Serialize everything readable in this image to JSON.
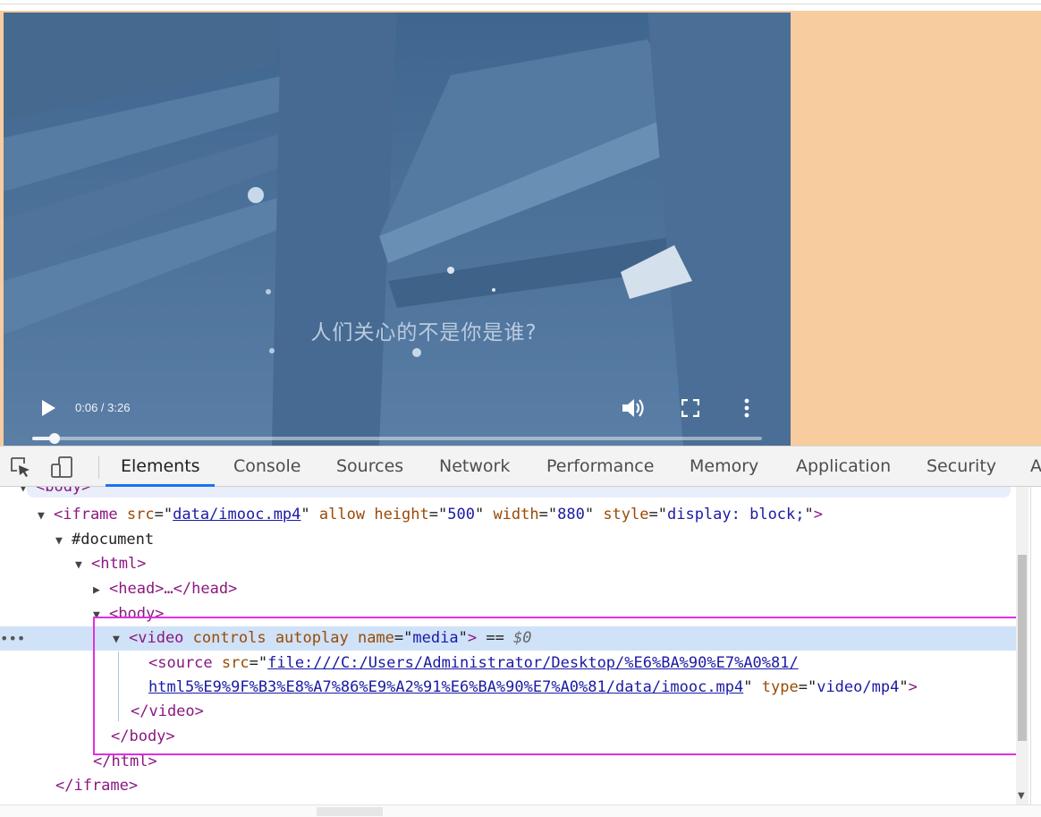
{
  "video": {
    "subtitle": "人们关心的不是你是谁?",
    "time": "0:06 / 3:26",
    "progress_fraction": 0.0306,
    "play_icon": "play-icon",
    "volume_icon": "volume-icon",
    "fullscreen_icon": "fullscreen-icon",
    "more_icon": "more-vert-icon"
  },
  "devtools": {
    "tabs": [
      {
        "label": "Elements",
        "active": true
      },
      {
        "label": "Console"
      },
      {
        "label": "Sources"
      },
      {
        "label": "Network"
      },
      {
        "label": "Performance"
      },
      {
        "label": "Memory"
      },
      {
        "label": "Application"
      },
      {
        "label": "Security"
      },
      {
        "label": "A"
      }
    ],
    "colors": {
      "accent": "#1a73e8",
      "highlight": "#e02fe0",
      "selected_row": "#cfe2f8"
    }
  },
  "dom": {
    "body_open_top": "<body>",
    "iframe": {
      "tag": "<iframe",
      "src_attr": "src",
      "src": "data/imooc.mp4",
      "allow": "allow",
      "height_attr": "height",
      "height": "500",
      "width_attr": "width",
      "width": "880",
      "style_attr": "style",
      "style": "display: block;",
      "close": ">"
    },
    "document": "#document",
    "html_open": "<html>",
    "head": "<head>…</head>",
    "body_open": "<body>",
    "video": {
      "tag": "<video",
      "controls": "controls",
      "autoplay": "autoplay",
      "name_attr": "name",
      "name": "media",
      "close": ">",
      "eq": "==",
      "ref": "$0"
    },
    "source": {
      "tag": "<source",
      "src_attr": "src",
      "src_line1": "file:///C:/Users/Administrator/Desktop/%E6%BA%90%E7%A0%81/",
      "src_line2": "html5%E9%9F%B3%E8%A7%86%E9%A2%91%E6%BA%90%E7%A0%81/data/imooc.mp4",
      "type_attr": "type",
      "type": "video/mp4",
      "close": ">"
    },
    "video_close": "</video>",
    "body_close": "</body>",
    "html_close": "</html>",
    "iframe_close": "</iframe>",
    "ellipsis": "•••"
  }
}
